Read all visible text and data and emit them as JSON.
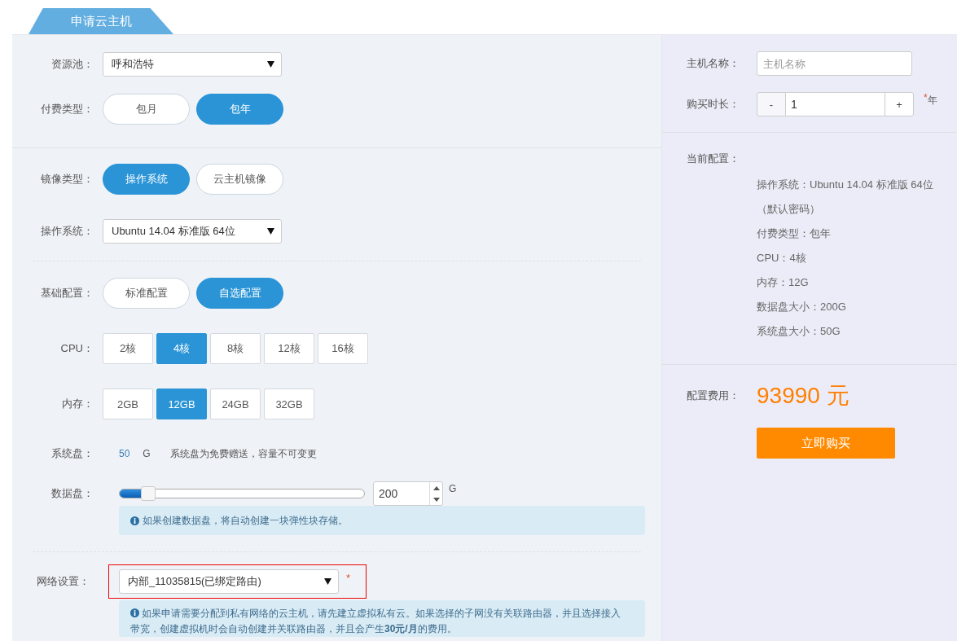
{
  "tab": {
    "label": "申请云主机"
  },
  "form": {
    "resource_pool": {
      "label": "资源池：",
      "value": "呼和浩特"
    },
    "billing_type": {
      "label": "付费类型：",
      "options": [
        {
          "label": "包月",
          "selected": false
        },
        {
          "label": "包年",
          "selected": true
        }
      ]
    },
    "image_type": {
      "label": "镜像类型：",
      "options": [
        {
          "label": "操作系统",
          "selected": true
        },
        {
          "label": "云主机镜像",
          "selected": false
        }
      ]
    },
    "os": {
      "label": "操作系统：",
      "value": "Ubuntu 14.04 标准版 64位"
    },
    "base_config": {
      "label": "基础配置：",
      "options": [
        {
          "label": "标准配置",
          "selected": false
        },
        {
          "label": "自选配置",
          "selected": true
        }
      ]
    },
    "cpu": {
      "label": "CPU：",
      "options": [
        {
          "label": "2核",
          "selected": false
        },
        {
          "label": "4核",
          "selected": true
        },
        {
          "label": "8核",
          "selected": false
        },
        {
          "label": "12核",
          "selected": false
        },
        {
          "label": "16核",
          "selected": false
        }
      ]
    },
    "memory": {
      "label": "内存：",
      "options": [
        {
          "label": "2GB",
          "selected": false
        },
        {
          "label": "12GB",
          "selected": true
        },
        {
          "label": "24GB",
          "selected": false
        },
        {
          "label": "32GB",
          "selected": false
        }
      ]
    },
    "system_disk": {
      "label": "系统盘：",
      "value": "50",
      "unit": "G",
      "note": "系统盘为免费赠送，容量不可变更"
    },
    "data_disk": {
      "label": "数据盘：",
      "level": 0.1,
      "value": "200",
      "unit": "G",
      "info": "如果创建数据盘，将自动创建一块弹性块存储。"
    },
    "network": {
      "label": "网络设置：",
      "value": "内部_11035815(已绑定路由)",
      "required_mark": "*",
      "highlighted": true,
      "info": "如果申请需要分配到私有网络的云主机，请先建立虚拟私有云。如果选择的子网没有关联路由器，并且选择接入带宽，创建虚拟机时会自动创建并关联路由器，并且会产生**30元/月**的费用。"
    }
  },
  "summary": {
    "host_name": {
      "label": "主机名称：",
      "placeholder": "主机名称"
    },
    "duration": {
      "label": "购买时长：",
      "minus": "-",
      "value": "1",
      "plus": "+",
      "required_mark": "*",
      "unit": "年"
    },
    "current_config": {
      "label": "当前配置：",
      "lines": [
        "操作系统：Ubuntu 14.04 标准版 64位（默认密码）",
        "付费类型：包年",
        "CPU：4核",
        "内存：12G",
        "数据盘大小：200G",
        "系统盘大小：50G"
      ]
    },
    "fee": {
      "label": "配置费用：",
      "value": "93990 元"
    },
    "buy_button": "立即购买"
  }
}
